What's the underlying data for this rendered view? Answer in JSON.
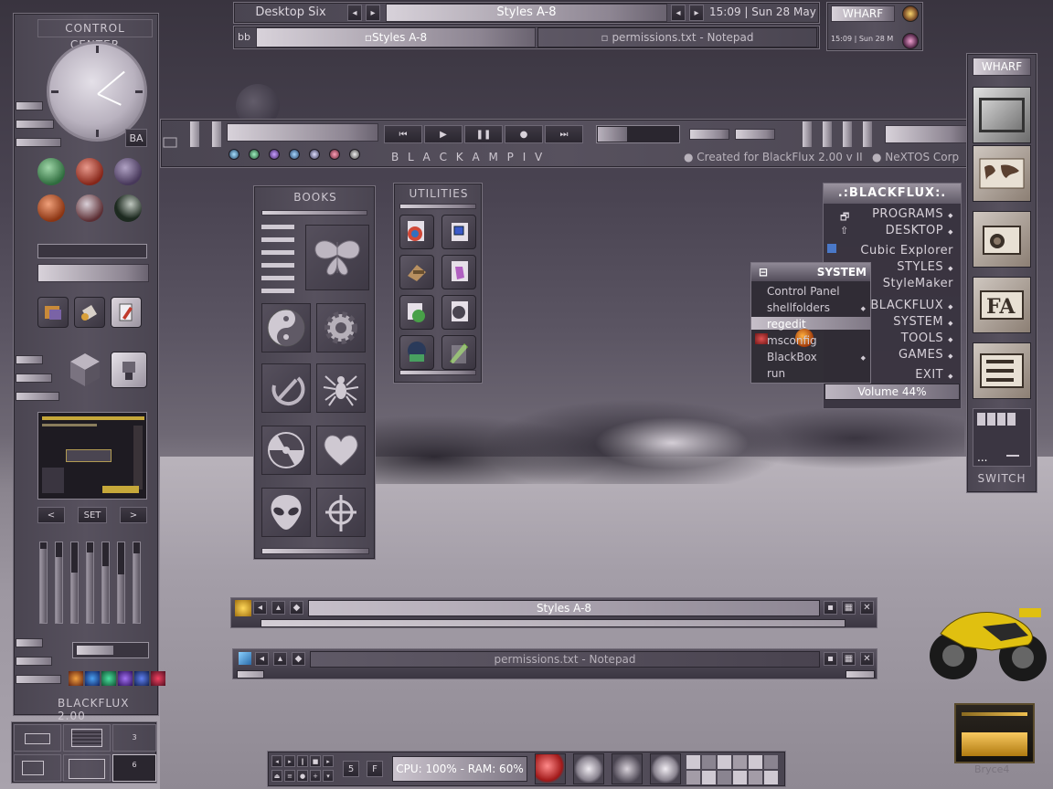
{
  "control_center": {
    "title": "CONTROL CENTER",
    "badge": "BA",
    "set_label": "SET",
    "prev_label": "<",
    "next_label": ">",
    "footer": "BLACKFLUX 2.00",
    "mini_labels": [
      "3",
      "6"
    ],
    "slider_levels": [
      0.92,
      0.82,
      0.62,
      0.88,
      0.7,
      0.6,
      0.86
    ]
  },
  "top_taskbar": {
    "workspace": "Desktop Six",
    "style_name": "Styles A-8",
    "clock": "15:09 | Sun 28 May",
    "bb_label": "bb",
    "tasks": [
      {
        "label": "Styles A-8",
        "active": true
      },
      {
        "label": "permissions.txt - Notepad",
        "active": false
      }
    ]
  },
  "wharf_top": {
    "label": "WHARF",
    "clock": "15:09 | Sun 28 M"
  },
  "blackamp": {
    "title": "B L A C K A M P  I V",
    "credit": "Created for BlackFlux 2.00 v II",
    "corp": "NeXTOS Corp"
  },
  "books": {
    "title": "BOOKS",
    "icons": [
      "moth-icon",
      "yin-yang-icon",
      "gear-icon",
      "hammer-sickle-icon",
      "spider-icon",
      "radiation-icon",
      "heart-icon",
      "alien-icon",
      "crosshair-icon"
    ]
  },
  "utilities": {
    "title": "UTILITIES"
  },
  "blackflux_menu": {
    "title": ".:BLACKFLUX:.",
    "items": [
      {
        "label": "PROGRAMS",
        "submenu": true
      },
      {
        "label": "DESKTOP",
        "submenu": true
      },
      {
        "label": "Cubic Explorer",
        "submenu": false
      },
      {
        "label": "STYLES",
        "submenu": true
      },
      {
        "label": "StyleMaker",
        "submenu": false
      },
      {
        "label": "BLACKFLUX",
        "submenu": true
      },
      {
        "label": "SYSTEM",
        "submenu": true
      },
      {
        "label": "TOOLS",
        "submenu": true
      },
      {
        "label": "GAMES",
        "submenu": true
      },
      {
        "label": "EXIT",
        "submenu": true
      }
    ],
    "volume": "Volume 44%"
  },
  "system_menu": {
    "title": "SYSTEM",
    "items": [
      {
        "label": "Control Panel"
      },
      {
        "label": "shellfolders"
      },
      {
        "label": "regedit"
      },
      {
        "label": "msconfig"
      },
      {
        "label": "BlackBox"
      },
      {
        "label": "run"
      }
    ]
  },
  "wharf_right": {
    "title": "WHARF",
    "switch_label": "SWITCH",
    "dots": "..."
  },
  "windows": [
    {
      "title": "Styles A-8",
      "active": true
    },
    {
      "title": "permissions.txt - Notepad",
      "active": false
    }
  ],
  "bottom_taskbar": {
    "count": "5",
    "f_label": "F",
    "cpu": "CPU: 100% - RAM: 60%"
  },
  "desktop": {
    "bryce_label": "Bryce4"
  }
}
